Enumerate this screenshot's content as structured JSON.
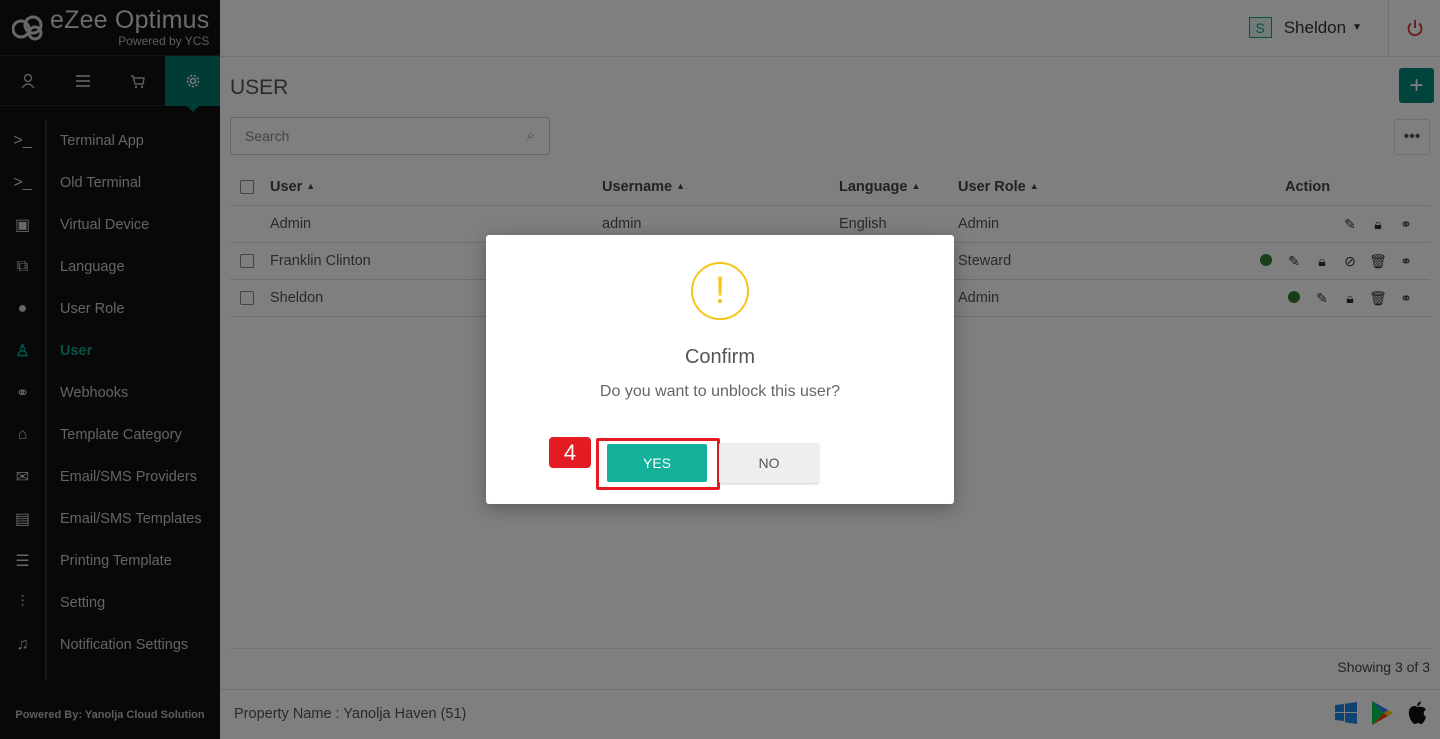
{
  "brand": {
    "name": "eZee Optimus",
    "sub": "Powered by YCS"
  },
  "topnav": [
    {
      "icon": "user-icon"
    },
    {
      "icon": "menu-icon"
    },
    {
      "icon": "cart-icon"
    },
    {
      "icon": "settings-icon",
      "active": true
    }
  ],
  "sidebar": {
    "items": [
      {
        "label": "Terminal App",
        "icon": "terminal-icon"
      },
      {
        "label": "Old Terminal",
        "icon": "terminal-icon"
      },
      {
        "label": "Virtual Device",
        "icon": "tablet-icon"
      },
      {
        "label": "Language",
        "icon": "translate-icon"
      },
      {
        "label": "User Role",
        "icon": "person-icon"
      },
      {
        "label": "User",
        "icon": "user-icon",
        "active": true
      },
      {
        "label": "Webhooks",
        "icon": "link-icon"
      },
      {
        "label": "Template Category",
        "icon": "inbox-icon"
      },
      {
        "label": "Email/SMS Providers",
        "icon": "mail-icon"
      },
      {
        "label": "Email/SMS Templates",
        "icon": "film-icon"
      },
      {
        "label": "Printing Template",
        "icon": "receipt-icon"
      },
      {
        "label": "Setting",
        "icon": "sliders-icon"
      },
      {
        "label": "Notification Settings",
        "icon": "bell-icon"
      }
    ],
    "powered_by": "Powered By: Yanolja Cloud Solution"
  },
  "header": {
    "user_initial": "S",
    "user_name": "Sheldon"
  },
  "page": {
    "title": "USER",
    "add_label": "+",
    "more_label": "•••"
  },
  "search": {
    "placeholder": "Search"
  },
  "table": {
    "columns": {
      "user": "User",
      "username": "Username",
      "language": "Language",
      "role": "User Role",
      "action": "Action"
    },
    "rows": [
      {
        "user": "Admin",
        "username": "admin",
        "language": "English",
        "role": "Admin"
      },
      {
        "user": "Franklin Clinton",
        "username": "",
        "language": "",
        "role": "Steward"
      },
      {
        "user": "Sheldon",
        "username": "",
        "language": "",
        "role": "Admin"
      }
    ],
    "showing": "Showing 3 of 3"
  },
  "footer": {
    "property": "Property Name : Yanolja Haven (51)"
  },
  "dialog": {
    "icon": "!",
    "title": "Confirm",
    "message": "Do you want to unblock this user?",
    "yes": "YES",
    "no": "NO",
    "step": "4"
  },
  "colors": {
    "accent": "#00897b",
    "highlight": "#e51b24",
    "warning": "#f5c518"
  }
}
